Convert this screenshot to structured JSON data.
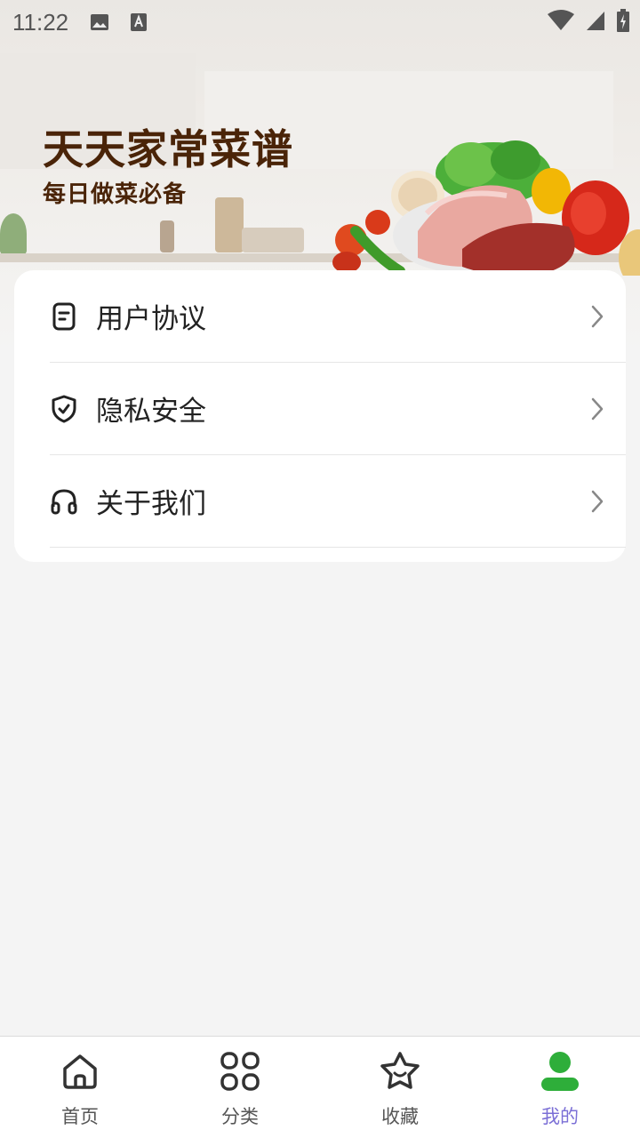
{
  "status_bar": {
    "time": "11:22"
  },
  "banner": {
    "title": "天天家常菜谱",
    "subtitle": "每日做菜必备"
  },
  "menu": {
    "items": [
      {
        "label": "用户协议",
        "icon": "document-icon"
      },
      {
        "label": "隐私安全",
        "icon": "shield-check-icon"
      },
      {
        "label": "关于我们",
        "icon": "headphones-icon"
      }
    ]
  },
  "tabbar": {
    "tabs": [
      {
        "label": "首页",
        "icon": "home-icon"
      },
      {
        "label": "分类",
        "icon": "grid-icon"
      },
      {
        "label": "收藏",
        "icon": "star-icon"
      },
      {
        "label": "我的",
        "icon": "user-icon"
      }
    ],
    "active_color": "#7b6fd6",
    "active_icon_color": "#2eae3a"
  }
}
